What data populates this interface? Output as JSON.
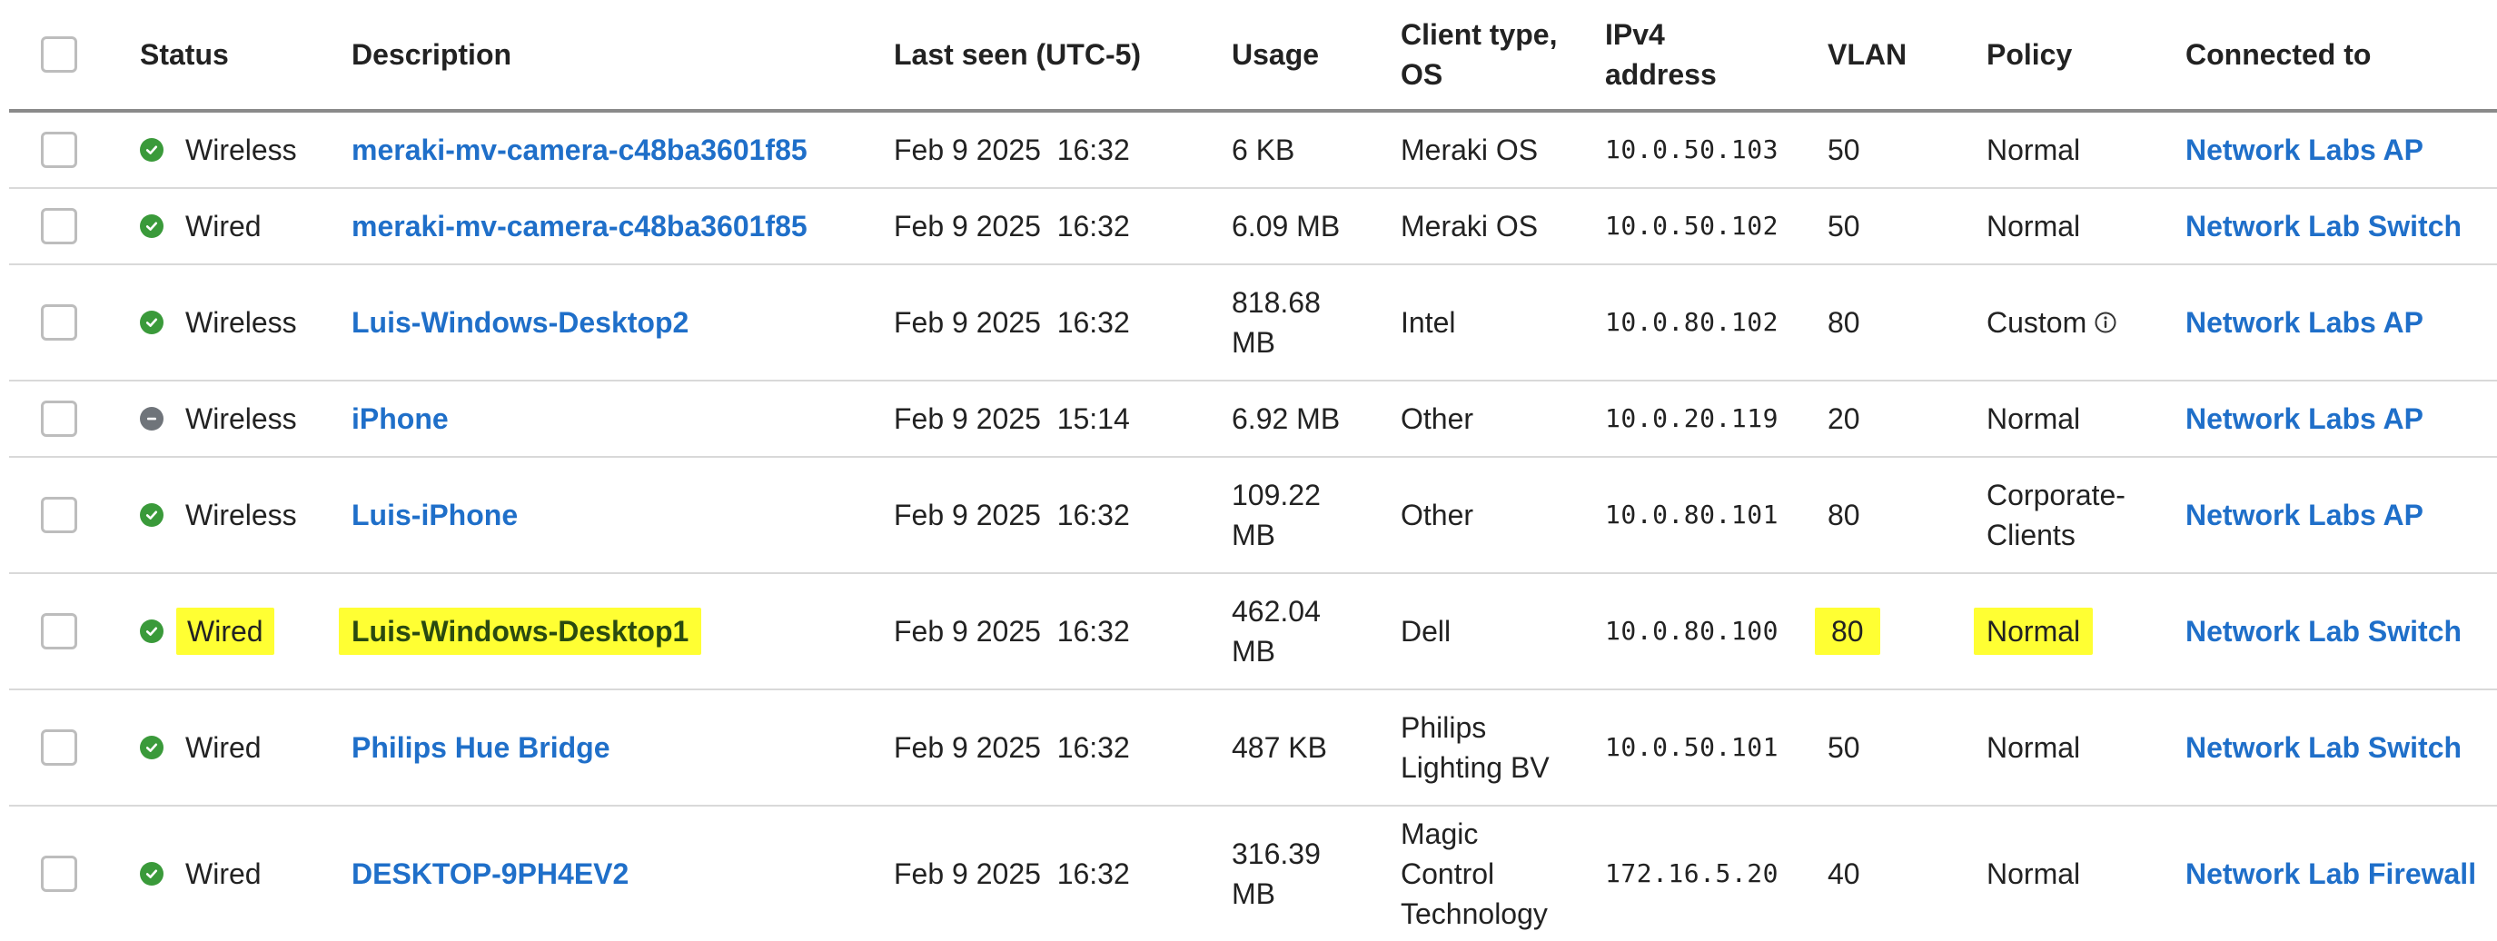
{
  "table": {
    "headers": {
      "status": "Status",
      "description": "Description",
      "last_seen": "Last seen (UTC-5)",
      "usage": "Usage",
      "client_type": "Client type, OS",
      "ipv4": "IPv4 address",
      "vlan": "VLAN",
      "policy": "Policy",
      "connected_to": "Connected to"
    },
    "rows": [
      {
        "status_icon": "check-circle-icon",
        "status_state": "online",
        "status": "Wireless",
        "description": "meraki-mv-camera-c48ba3601f85",
        "last_seen": "Feb 9 2025  16:32",
        "usage": "6 KB",
        "client_type": "Meraki OS",
        "ipv4": "10.0.50.103",
        "vlan": "50",
        "policy": "Normal",
        "connected_to": "Network Labs AP"
      },
      {
        "status_icon": "check-circle-icon",
        "status_state": "online",
        "status": "Wired",
        "description": "meraki-mv-camera-c48ba3601f85",
        "last_seen": "Feb 9 2025  16:32",
        "usage": "6.09 MB",
        "client_type": "Meraki OS",
        "ipv4": "10.0.50.102",
        "vlan": "50",
        "policy": "Normal",
        "connected_to": "Network Lab Switch"
      },
      {
        "status_icon": "check-circle-icon",
        "status_state": "online",
        "status": "Wireless",
        "description": "Luis-Windows-Desktop2",
        "last_seen": "Feb 9 2025  16:32",
        "usage": "818.68 MB",
        "client_type": "Intel",
        "ipv4": "10.0.80.102",
        "vlan": "80",
        "policy": "Custom",
        "policy_info_icon": "info-circle-icon",
        "connected_to": "Network Labs AP"
      },
      {
        "status_icon": "minus-circle-icon",
        "status_state": "idle",
        "status": "Wireless",
        "description": "iPhone",
        "last_seen": "Feb 9 2025  15:14",
        "usage": "6.92 MB",
        "client_type": "Other",
        "ipv4": "10.0.20.119",
        "vlan": "20",
        "policy": "Normal",
        "connected_to": "Network Labs AP"
      },
      {
        "status_icon": "check-circle-icon",
        "status_state": "online",
        "status": "Wireless",
        "description": "Luis-iPhone",
        "last_seen": "Feb 9 2025  16:32",
        "usage": "109.22 MB",
        "client_type": "Other",
        "ipv4": "10.0.80.101",
        "vlan": "80",
        "policy": "Corporate-Clients",
        "connected_to": "Network Labs AP"
      },
      {
        "status_icon": "check-circle-icon",
        "status_state": "online",
        "status": "Wired",
        "description": "Luis-Windows-Desktop1",
        "last_seen": "Feb 9 2025  16:32",
        "usage": "462.04 MB",
        "client_type": "Dell",
        "ipv4": "10.0.80.100",
        "vlan": "80",
        "policy": "Normal",
        "connected_to": "Network Lab Switch",
        "highlight_color": "#ffff33"
      },
      {
        "status_icon": "check-circle-icon",
        "status_state": "online",
        "status": "Wired",
        "description": "Philips Hue Bridge",
        "last_seen": "Feb 9 2025  16:32",
        "usage": "487 KB",
        "client_type": "Philips Lighting BV",
        "ipv4": "10.0.50.101",
        "vlan": "50",
        "policy": "Normal",
        "connected_to": "Network Lab Switch"
      },
      {
        "status_icon": "check-circle-icon",
        "status_state": "online",
        "status": "Wired",
        "description": "DESKTOP-9PH4EV2",
        "last_seen": "Feb 9 2025  16:32",
        "usage": "316.39 MB",
        "client_type": "Magic Control Technology",
        "ipv4": "172.16.5.20",
        "vlan": "40",
        "policy": "Normal",
        "connected_to": "Network Lab Firewall"
      }
    ]
  },
  "colors": {
    "link": "#1f6fc9",
    "online": "#3a9a3a",
    "idle": "#6f747a",
    "highlight": "#ffff33"
  }
}
